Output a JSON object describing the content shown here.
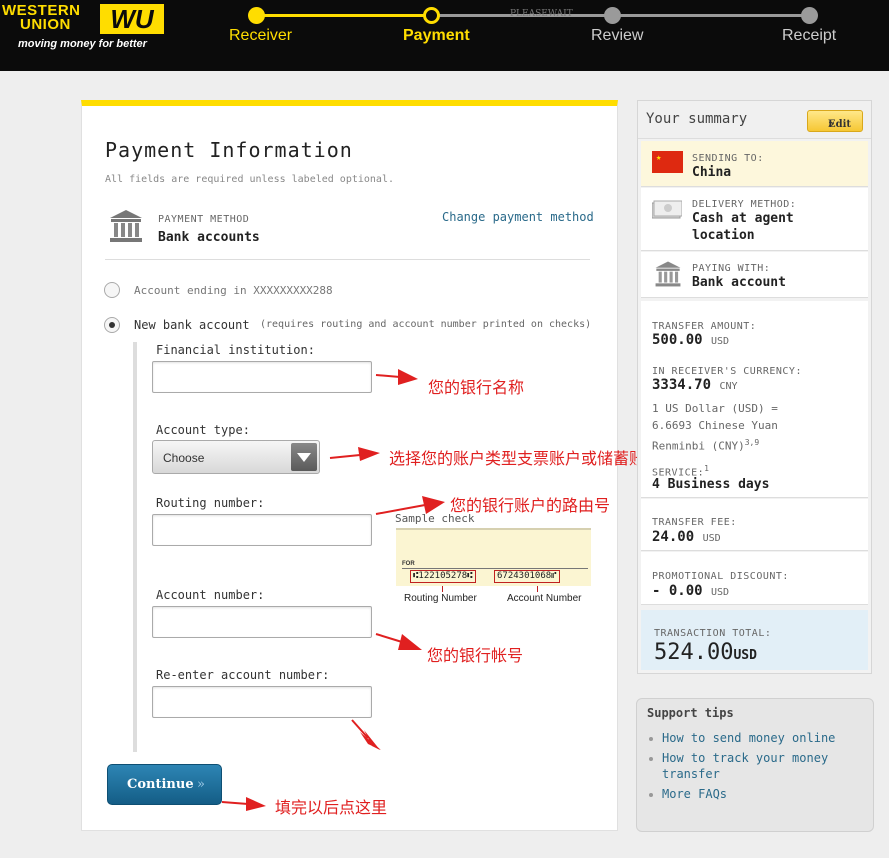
{
  "brand": {
    "line1": "WESTERN",
    "line2": "UNION",
    "mark": "WU",
    "tagline": "moving money for better",
    "yellow": "#ffdd00"
  },
  "steps": [
    {
      "label": "Receiver",
      "state": "done"
    },
    {
      "label": "Payment",
      "state": "current"
    },
    {
      "label": "Review",
      "state": "todo"
    },
    {
      "label": "Receipt",
      "state": "todo"
    }
  ],
  "payment": {
    "title": "Payment Information",
    "subtitle": "All fields are required unless labeled optional.",
    "method_label": "PAYMENT METHOD",
    "method_value": "Bank accounts",
    "change_link": "Change payment method",
    "option_existing": "Account ending in XXXXXXXXX288",
    "option_new": "New bank account",
    "option_new_note": "(requires routing and account number printed on checks)",
    "financial_institution_label": "Financial institution:",
    "financial_institution_value": "",
    "account_type_label": "Account type:",
    "account_type_selected": "Choose",
    "routing_label": "Routing number:",
    "routing_value": "",
    "account_number_label": "Account number:",
    "account_number_value": "",
    "reenter_label": "Re-enter account number:",
    "reenter_value": "",
    "sample_check_caption": "Sample check",
    "check_for": "FOR",
    "check_routing_digits": "⑆122105278⑆",
    "check_account_digits": "6724301068⑈",
    "check_routing_label": "Routing Number",
    "check_account_label": "Account Number",
    "continue_label": "Continue",
    "continue_chevron": "»"
  },
  "annotations": {
    "bank_name": "您的银行名称",
    "account_type": "选择您的账户类型支票账户或储蓄账户",
    "routing": "您的银行账户的路由号",
    "account_number": "您的银行帐号",
    "continue": "填完以后点这里",
    "color": "#e02020"
  },
  "summary": {
    "title": "Your summary",
    "edit": "Edit",
    "edit_chevron": "»",
    "sending_to_label": "SENDING TO:",
    "sending_to_value": "China",
    "delivery_label": "DELIVERY METHOD:",
    "delivery_value_1": "Cash at agent",
    "delivery_value_2": "location",
    "paying_label": "PAYING WITH:",
    "paying_value": "Bank account",
    "transfer_amount_label": "TRANSFER AMOUNT:",
    "transfer_amount": "500.00",
    "currency_usd": "USD",
    "receiver_currency_label": "IN RECEIVER'S CURRENCY:",
    "receiver_amount": "3334.70",
    "currency_cny": "CNY",
    "rate_line1": "1 US Dollar (USD) =",
    "rate_line2": "6.6693 Chinese Yuan",
    "rate_line3": "Renminbi (CNY)",
    "rate_sup": "3,9",
    "service_label": "SERVICE:",
    "service_sup": "1",
    "service_value": "4 Business days",
    "fee_label": "TRANSFER FEE:",
    "fee_value": "24.00",
    "promo_label": "PROMOTIONAL DISCOUNT:",
    "promo_value": "- 0.00",
    "total_label": "TRANSACTION TOTAL:",
    "total_value": "524.00"
  },
  "support": {
    "title": "Support tips",
    "tip1": "How to send money online",
    "tip2_line1": "How to track your money",
    "tip2_line2": "transfer",
    "tip3": "More FAQs"
  }
}
